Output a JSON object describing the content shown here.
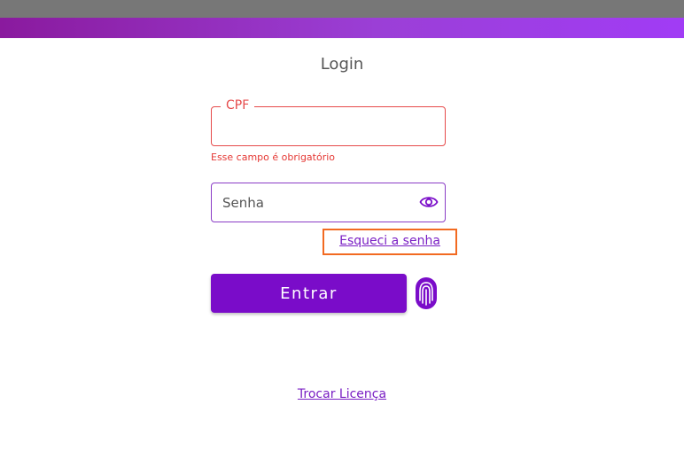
{
  "header": {
    "title": "Login"
  },
  "form": {
    "cpf": {
      "label": "CPF",
      "value": "",
      "error": "Esse campo é obrigatório"
    },
    "senha": {
      "placeholder": "Senha",
      "value": ""
    },
    "forgot_password": "Esqueci a senha",
    "submit_label": "Entrar"
  },
  "footer": {
    "change_license": "Trocar Licença"
  },
  "colors": {
    "accent": "#7a0cc9",
    "error": "#e53935",
    "highlight_box": "#f26a21",
    "top_bar": "#777777"
  },
  "icons": {
    "password_toggle": "eye-icon",
    "biometric": "fingerprint-icon"
  }
}
